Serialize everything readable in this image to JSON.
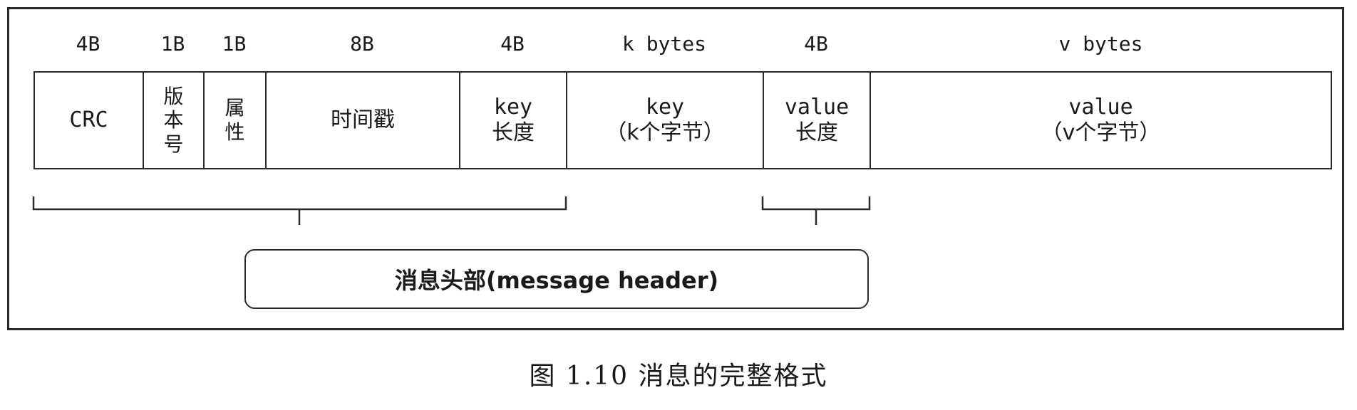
{
  "fields": [
    {
      "size": "4B",
      "line1": "CRC",
      "line2": ""
    },
    {
      "size": "1B",
      "vertical": [
        "版",
        "本",
        "号"
      ]
    },
    {
      "size": "1B",
      "vertical": [
        "属",
        "性"
      ]
    },
    {
      "size": "8B",
      "line1": "时间戳",
      "line2": ""
    },
    {
      "size": "4B",
      "line1": "key",
      "line2": "长度"
    },
    {
      "size": "k bytes",
      "line1": "key",
      "line2": "（k个字节）"
    },
    {
      "size": "4B",
      "line1": "value",
      "line2": "长度"
    },
    {
      "size": "v bytes",
      "line1": "value",
      "line2": "（v个字节）"
    }
  ],
  "header_label": "消息头部(message header)",
  "caption": "图 1.10   消息的完整格式"
}
